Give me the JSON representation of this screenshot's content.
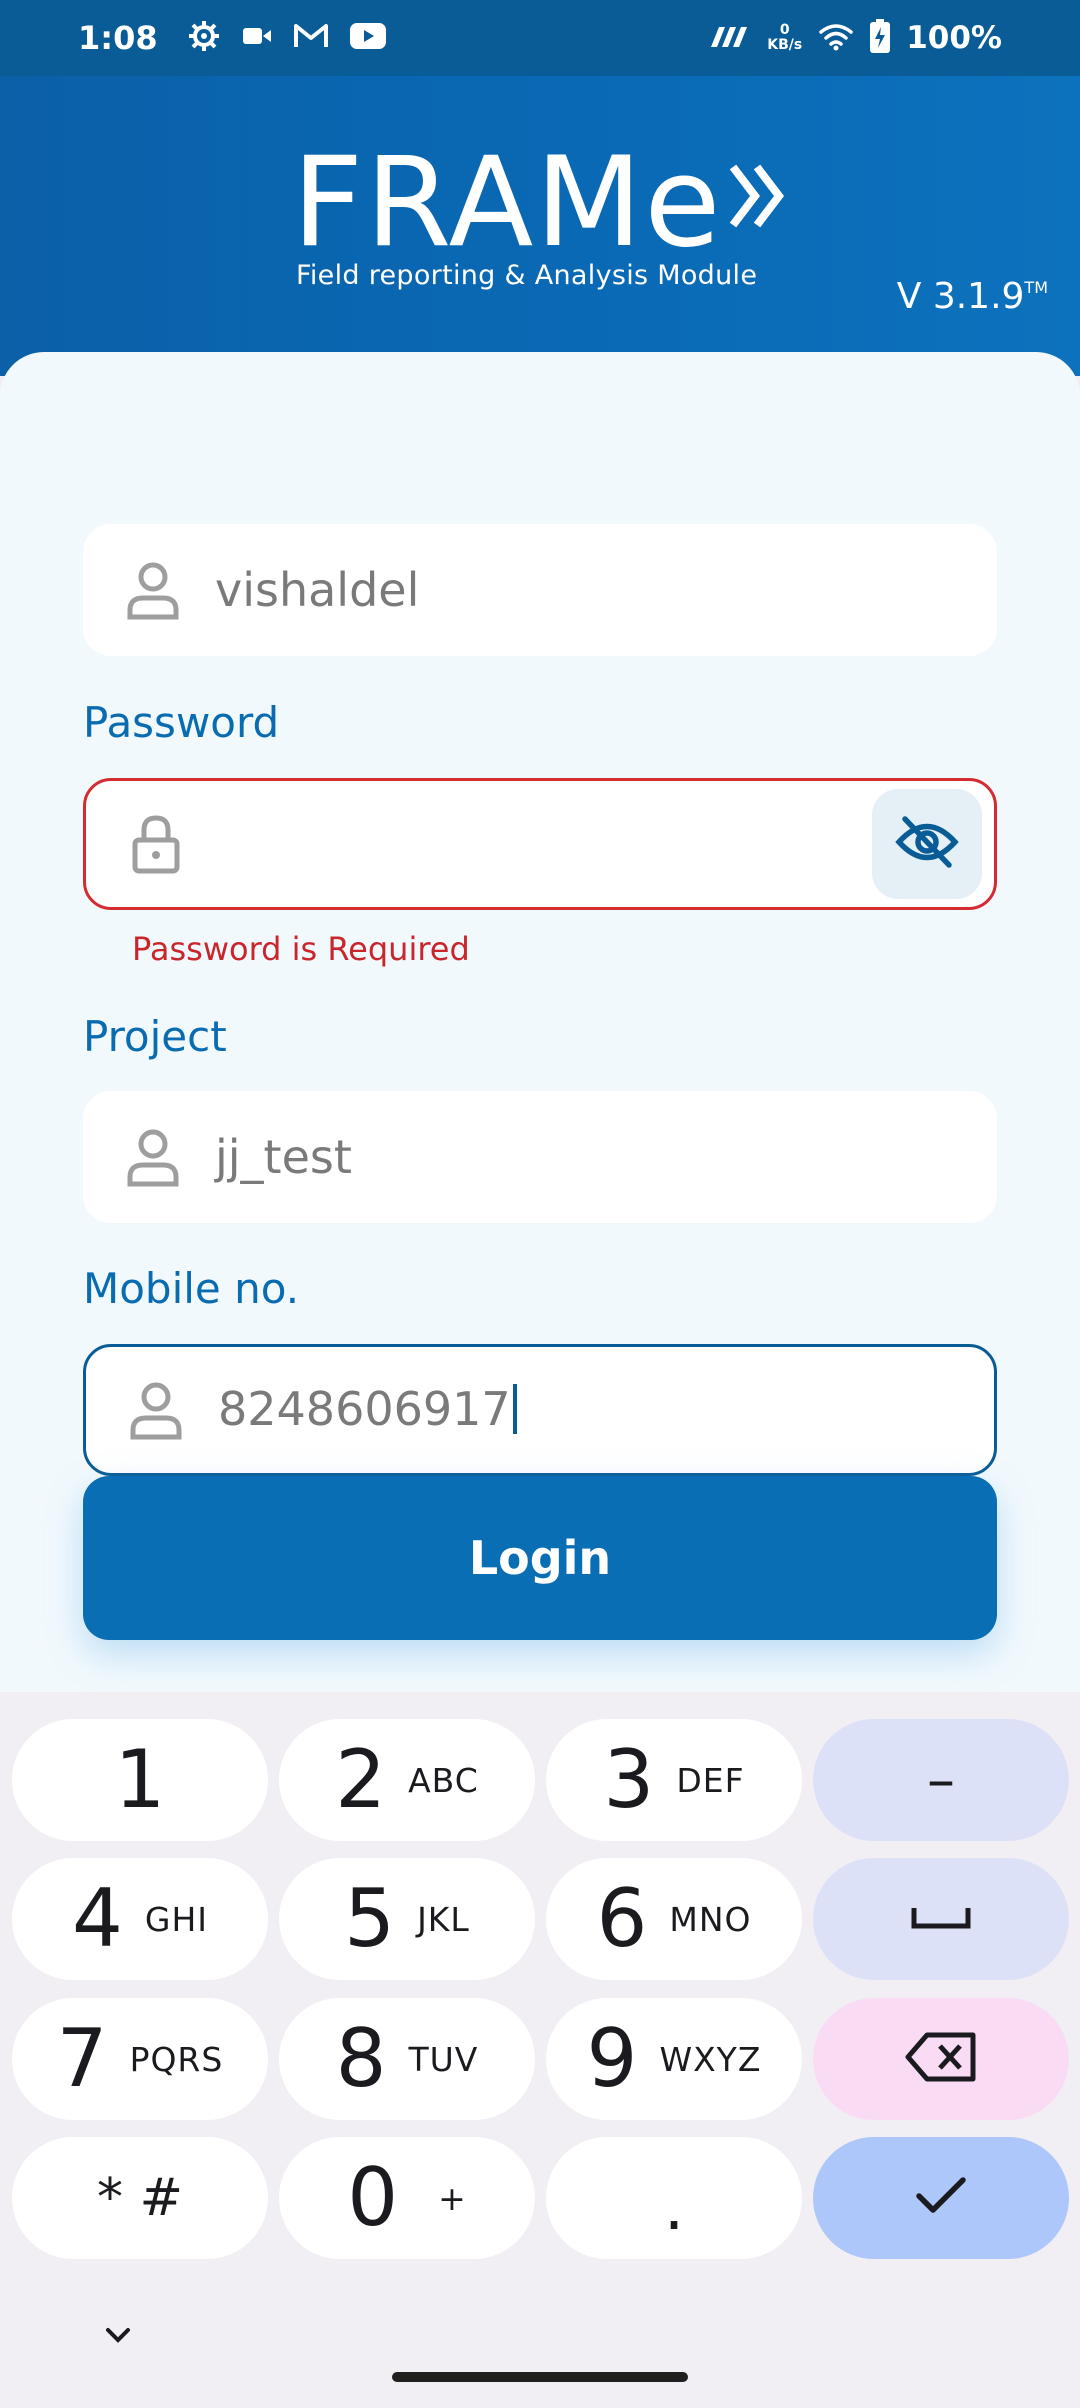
{
  "status_bar": {
    "time": "1:08",
    "icons": [
      "settings-icon",
      "video-icon",
      "gmail-icon",
      "youtube-icon"
    ],
    "network_speed_value": "0",
    "network_speed_unit": "KB/s",
    "battery": "100%"
  },
  "header": {
    "logo_text": "FRAMe",
    "tagline": "Field reporting & Analysis Module",
    "version": "V 3.1.9",
    "trademark": "TM"
  },
  "form": {
    "username_value": "vishaldel",
    "password_label": "Password",
    "password_value": "",
    "password_error": "Password is Required",
    "project_label": "Project",
    "project_value": "jj_test",
    "mobile_label": "Mobile no.",
    "mobile_value": "8248606917",
    "login_label": "Login"
  },
  "keyboard": {
    "keys": [
      {
        "num": "1",
        "sub": ""
      },
      {
        "num": "2",
        "sub": "ABC"
      },
      {
        "num": "3",
        "sub": "DEF"
      },
      {
        "num": "4",
        "sub": "GHI"
      },
      {
        "num": "5",
        "sub": "JKL"
      },
      {
        "num": "6",
        "sub": "MNO"
      },
      {
        "num": "7",
        "sub": "PQRS"
      },
      {
        "num": "8",
        "sub": "TUV"
      },
      {
        "num": "9",
        "sub": "WXYZ"
      },
      {
        "num": "* #",
        "sub": ""
      },
      {
        "num": "0",
        "sub": "+"
      },
      {
        "num": ".",
        "sub": ""
      }
    ],
    "dash_key": "–"
  },
  "colors": {
    "brand_blue": "#0a6eb4",
    "status_bar": "#0a5c96",
    "error_red": "#d42b32"
  }
}
